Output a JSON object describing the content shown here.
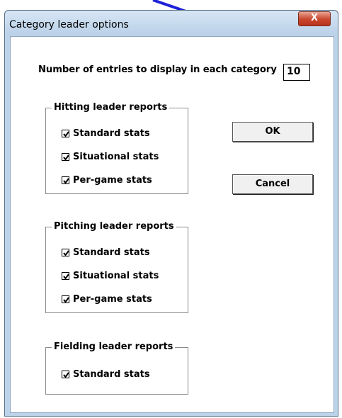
{
  "window": {
    "title": "Category leader options",
    "close_glyph": "X"
  },
  "entries": {
    "label": "Number of entries to display in each category",
    "value": "10"
  },
  "groups": {
    "hitting": {
      "title": "Hitting leader reports",
      "items": [
        {
          "label": "Standard stats",
          "checked": true
        },
        {
          "label": "Situational stats",
          "checked": true
        },
        {
          "label": "Per-game stats",
          "checked": true
        }
      ]
    },
    "pitching": {
      "title": "Pitching leader reports",
      "items": [
        {
          "label": "Standard stats",
          "checked": true
        },
        {
          "label": "Situational stats",
          "checked": true
        },
        {
          "label": "Per-game stats",
          "checked": true
        }
      ]
    },
    "fielding": {
      "title": "Fielding leader reports",
      "items": [
        {
          "label": "Standard stats",
          "checked": true
        }
      ]
    }
  },
  "buttons": {
    "ok": "OK",
    "cancel": "Cancel"
  },
  "annotation": {
    "arrow_color": "#1e22d8",
    "icon": "arrow-pointer-icon"
  }
}
